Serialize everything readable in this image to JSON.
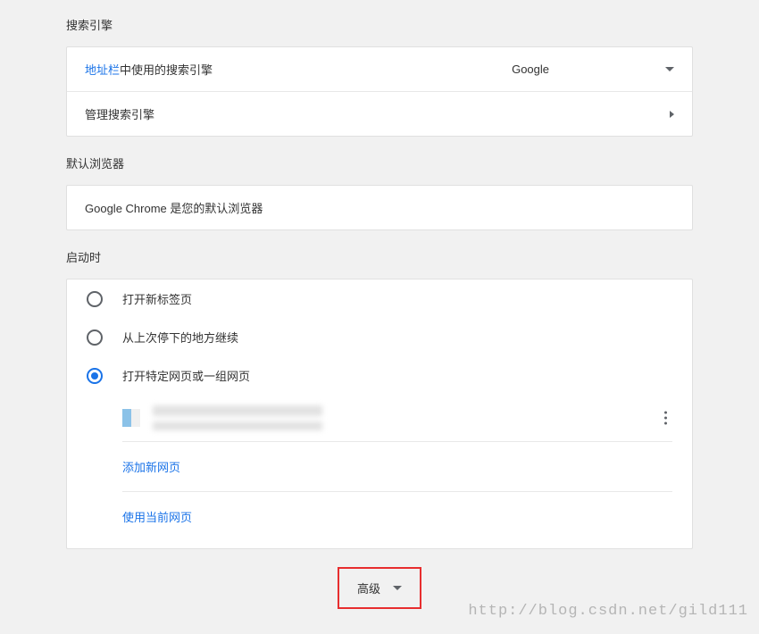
{
  "sections": {
    "searchEngine": {
      "title": "搜索引擎",
      "addressBarLink": "地址栏",
      "addressBarText": "中使用的搜索引擎",
      "selectedEngine": "Google",
      "manageLabel": "管理搜索引擎"
    },
    "defaultBrowser": {
      "title": "默认浏览器",
      "statusText": "Google Chrome 是您的默认浏览器"
    },
    "startup": {
      "title": "启动时",
      "options": [
        {
          "label": "打开新标签页",
          "selected": false
        },
        {
          "label": "从上次停下的地方继续",
          "selected": false
        },
        {
          "label": "打开特定网页或一组网页",
          "selected": true
        }
      ],
      "addNewPage": "添加新网页",
      "useCurrentPages": "使用当前网页"
    }
  },
  "advancedButton": "高级",
  "watermark": "http://blog.csdn.net/gild111"
}
